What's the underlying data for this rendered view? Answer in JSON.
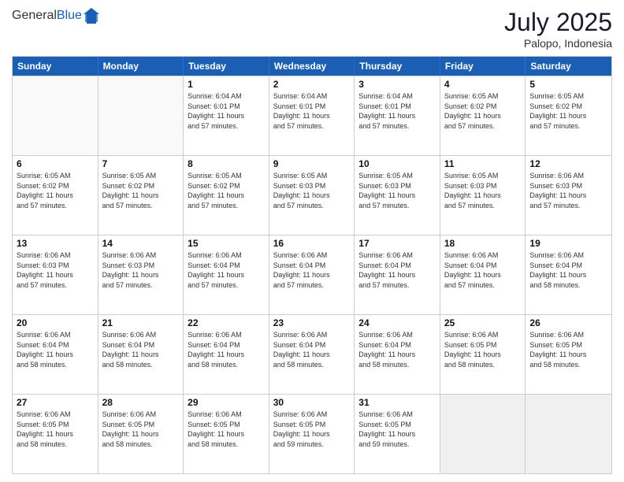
{
  "header": {
    "logo_general": "General",
    "logo_blue": "Blue",
    "month_year": "July 2025",
    "location": "Palopo, Indonesia"
  },
  "days_of_week": [
    "Sunday",
    "Monday",
    "Tuesday",
    "Wednesday",
    "Thursday",
    "Friday",
    "Saturday"
  ],
  "weeks": [
    [
      {
        "day": "",
        "empty": true
      },
      {
        "day": "",
        "empty": true
      },
      {
        "day": "1",
        "lines": [
          "Sunrise: 6:04 AM",
          "Sunset: 6:01 PM",
          "Daylight: 11 hours",
          "and 57 minutes."
        ]
      },
      {
        "day": "2",
        "lines": [
          "Sunrise: 6:04 AM",
          "Sunset: 6:01 PM",
          "Daylight: 11 hours",
          "and 57 minutes."
        ]
      },
      {
        "day": "3",
        "lines": [
          "Sunrise: 6:04 AM",
          "Sunset: 6:01 PM",
          "Daylight: 11 hours",
          "and 57 minutes."
        ]
      },
      {
        "day": "4",
        "lines": [
          "Sunrise: 6:05 AM",
          "Sunset: 6:02 PM",
          "Daylight: 11 hours",
          "and 57 minutes."
        ]
      },
      {
        "day": "5",
        "lines": [
          "Sunrise: 6:05 AM",
          "Sunset: 6:02 PM",
          "Daylight: 11 hours",
          "and 57 minutes."
        ]
      }
    ],
    [
      {
        "day": "6",
        "lines": [
          "Sunrise: 6:05 AM",
          "Sunset: 6:02 PM",
          "Daylight: 11 hours",
          "and 57 minutes."
        ]
      },
      {
        "day": "7",
        "lines": [
          "Sunrise: 6:05 AM",
          "Sunset: 6:02 PM",
          "Daylight: 11 hours",
          "and 57 minutes."
        ]
      },
      {
        "day": "8",
        "lines": [
          "Sunrise: 6:05 AM",
          "Sunset: 6:02 PM",
          "Daylight: 11 hours",
          "and 57 minutes."
        ]
      },
      {
        "day": "9",
        "lines": [
          "Sunrise: 6:05 AM",
          "Sunset: 6:03 PM",
          "Daylight: 11 hours",
          "and 57 minutes."
        ]
      },
      {
        "day": "10",
        "lines": [
          "Sunrise: 6:05 AM",
          "Sunset: 6:03 PM",
          "Daylight: 11 hours",
          "and 57 minutes."
        ]
      },
      {
        "day": "11",
        "lines": [
          "Sunrise: 6:05 AM",
          "Sunset: 6:03 PM",
          "Daylight: 11 hours",
          "and 57 minutes."
        ]
      },
      {
        "day": "12",
        "lines": [
          "Sunrise: 6:06 AM",
          "Sunset: 6:03 PM",
          "Daylight: 11 hours",
          "and 57 minutes."
        ]
      }
    ],
    [
      {
        "day": "13",
        "lines": [
          "Sunrise: 6:06 AM",
          "Sunset: 6:03 PM",
          "Daylight: 11 hours",
          "and 57 minutes."
        ]
      },
      {
        "day": "14",
        "lines": [
          "Sunrise: 6:06 AM",
          "Sunset: 6:03 PM",
          "Daylight: 11 hours",
          "and 57 minutes."
        ]
      },
      {
        "day": "15",
        "lines": [
          "Sunrise: 6:06 AM",
          "Sunset: 6:04 PM",
          "Daylight: 11 hours",
          "and 57 minutes."
        ]
      },
      {
        "day": "16",
        "lines": [
          "Sunrise: 6:06 AM",
          "Sunset: 6:04 PM",
          "Daylight: 11 hours",
          "and 57 minutes."
        ]
      },
      {
        "day": "17",
        "lines": [
          "Sunrise: 6:06 AM",
          "Sunset: 6:04 PM",
          "Daylight: 11 hours",
          "and 57 minutes."
        ]
      },
      {
        "day": "18",
        "lines": [
          "Sunrise: 6:06 AM",
          "Sunset: 6:04 PM",
          "Daylight: 11 hours",
          "and 57 minutes."
        ]
      },
      {
        "day": "19",
        "lines": [
          "Sunrise: 6:06 AM",
          "Sunset: 6:04 PM",
          "Daylight: 11 hours",
          "and 58 minutes."
        ]
      }
    ],
    [
      {
        "day": "20",
        "lines": [
          "Sunrise: 6:06 AM",
          "Sunset: 6:04 PM",
          "Daylight: 11 hours",
          "and 58 minutes."
        ]
      },
      {
        "day": "21",
        "lines": [
          "Sunrise: 6:06 AM",
          "Sunset: 6:04 PM",
          "Daylight: 11 hours",
          "and 58 minutes."
        ]
      },
      {
        "day": "22",
        "lines": [
          "Sunrise: 6:06 AM",
          "Sunset: 6:04 PM",
          "Daylight: 11 hours",
          "and 58 minutes."
        ]
      },
      {
        "day": "23",
        "lines": [
          "Sunrise: 6:06 AM",
          "Sunset: 6:04 PM",
          "Daylight: 11 hours",
          "and 58 minutes."
        ]
      },
      {
        "day": "24",
        "lines": [
          "Sunrise: 6:06 AM",
          "Sunset: 6:04 PM",
          "Daylight: 11 hours",
          "and 58 minutes."
        ]
      },
      {
        "day": "25",
        "lines": [
          "Sunrise: 6:06 AM",
          "Sunset: 6:05 PM",
          "Daylight: 11 hours",
          "and 58 minutes."
        ]
      },
      {
        "day": "26",
        "lines": [
          "Sunrise: 6:06 AM",
          "Sunset: 6:05 PM",
          "Daylight: 11 hours",
          "and 58 minutes."
        ]
      }
    ],
    [
      {
        "day": "27",
        "lines": [
          "Sunrise: 6:06 AM",
          "Sunset: 6:05 PM",
          "Daylight: 11 hours",
          "and 58 minutes."
        ]
      },
      {
        "day": "28",
        "lines": [
          "Sunrise: 6:06 AM",
          "Sunset: 6:05 PM",
          "Daylight: 11 hours",
          "and 58 minutes."
        ]
      },
      {
        "day": "29",
        "lines": [
          "Sunrise: 6:06 AM",
          "Sunset: 6:05 PM",
          "Daylight: 11 hours",
          "and 58 minutes."
        ]
      },
      {
        "day": "30",
        "lines": [
          "Sunrise: 6:06 AM",
          "Sunset: 6:05 PM",
          "Daylight: 11 hours",
          "and 59 minutes."
        ]
      },
      {
        "day": "31",
        "lines": [
          "Sunrise: 6:06 AM",
          "Sunset: 6:05 PM",
          "Daylight: 11 hours",
          "and 59 minutes."
        ]
      },
      {
        "day": "",
        "empty": true,
        "shaded": true
      },
      {
        "day": "",
        "empty": true,
        "shaded": true
      }
    ]
  ]
}
